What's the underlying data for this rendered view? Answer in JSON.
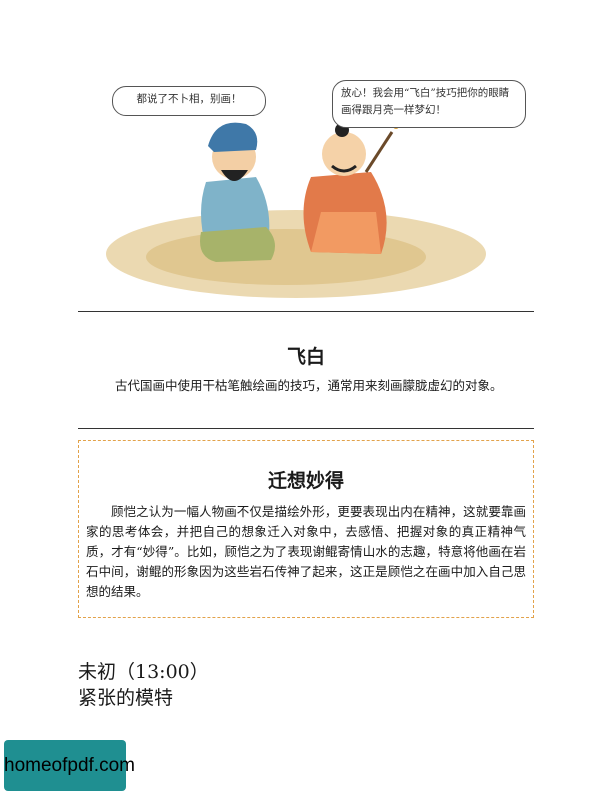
{
  "illustration": {
    "bubble_left": "都说了不卜相，别画！",
    "bubble_right": "放心！我会用“飞白”技巧把你的眼睛画得跟月亮一样梦幻！"
  },
  "section1": {
    "title": "飞白",
    "body": "古代国画中使用干枯笔触绘画的技巧，通常用来刻画朦胧虚幻的对象。"
  },
  "section2": {
    "title": "迁想妙得",
    "body": "顾恺之认为一幅人物画不仅是描绘外形，更要表现出内在精神，这就要靠画家的思考体会，并把自己的想象迁入对象中，去感悟、把握对象的真正精神气质，才有“妙得”。比如，顾恺之为了表现谢鲲寄情山水的志趣，特意将他画在岩石中间，谢鲲的形象因为这些岩石传神了起来，这正是顾恺之在画中加入自己思想的结果。"
  },
  "footer": {
    "time": "未初（13:00）",
    "subtitle": "紧张的模特"
  },
  "watermark": "homeofpdf.com"
}
